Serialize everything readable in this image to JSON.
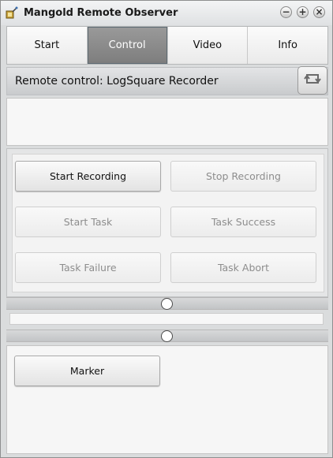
{
  "window": {
    "title": "Mangold Remote Observer",
    "controls": {
      "minimize": "−",
      "maximize": "+",
      "close": "×"
    }
  },
  "tabs": [
    {
      "label": "Start",
      "active": false
    },
    {
      "label": "Control",
      "active": true
    },
    {
      "label": "Video",
      "active": false
    },
    {
      "label": "Info",
      "active": false
    }
  ],
  "header": {
    "title": "Remote control: LogSquare Recorder",
    "refresh_icon": "refresh-icon"
  },
  "controls": {
    "start_recording": "Start Recording",
    "stop_recording": "Stop Recording",
    "start_task": "Start Task",
    "task_success": "Task Success",
    "task_failure": "Task Failure",
    "task_abort": "Task Abort"
  },
  "markers": {
    "marker": "Marker"
  },
  "colors": {
    "active_tab": "#888888",
    "window_bg": "#dadcdd",
    "disabled_text": "#8d8d8d"
  }
}
